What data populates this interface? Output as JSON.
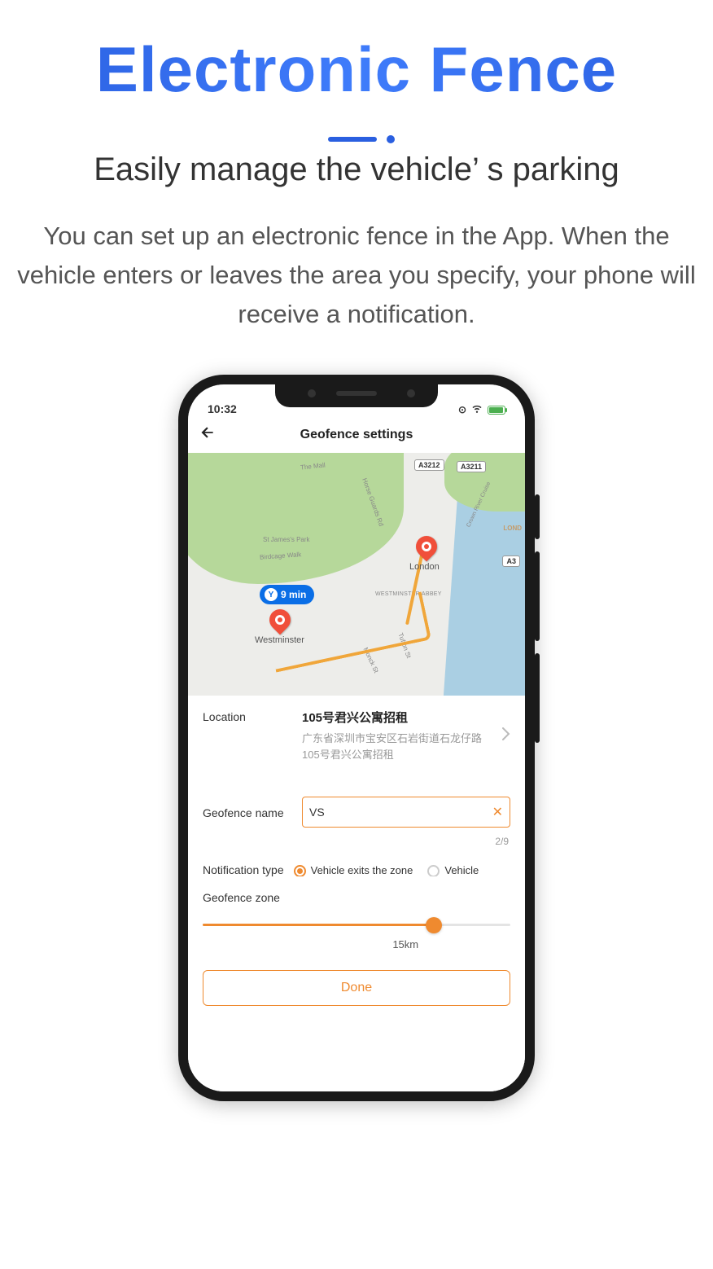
{
  "hero": {
    "title": "Electronic Fence",
    "subtitle": "Easily manage the vehicle’ s parking",
    "description": "You can set up an electronic fence in the App. When the vehicle enters or leaves the area you specify, your phone will receive a notification."
  },
  "statusbar": {
    "time": "10:32"
  },
  "navbar": {
    "title": "Geofence settings"
  },
  "map": {
    "bubble": "9 min",
    "pin1_label": "Westminster",
    "pin2_label": "London",
    "park_label": "St James's Park",
    "road1": "Birdcage Walk",
    "road2": "Horse Guards Rd",
    "road3": "The Mall",
    "road4": "Tufton St",
    "road5": "Monck St",
    "abbey": "WESTMINSTER ABBEY",
    "badge1": "A3212",
    "badge2": "A3211",
    "badge3": "A3",
    "crown": "Crown River Cruise",
    "lond": "LOND"
  },
  "form": {
    "location_label": "Location",
    "location_value": "105号君兴公寓招租",
    "location_sub": "广东省深圳市宝安区石岩街道石龙仔路105号君兴公寓招租",
    "name_label": "Geofence name",
    "name_value": "VS",
    "name_counter": "2/9",
    "notif_label": "Notification type",
    "notif_opt1": "Vehicle exits the zone",
    "notif_opt2": "Vehicle",
    "zone_label": "Geofence zone",
    "zone_value": "15km",
    "done": "Done"
  }
}
